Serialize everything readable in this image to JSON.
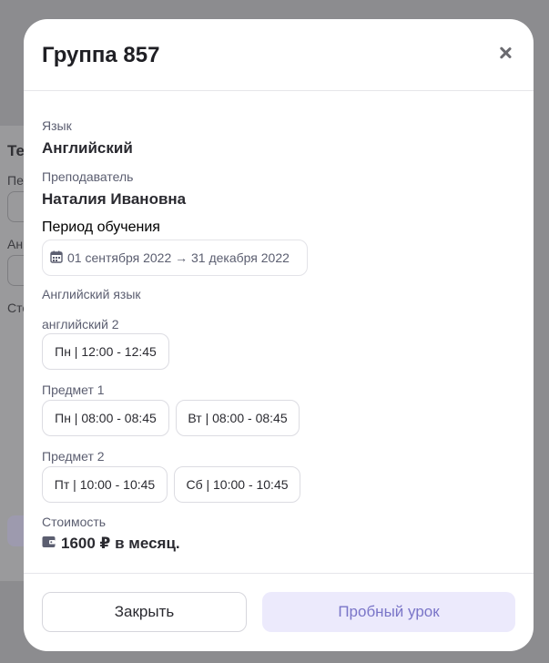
{
  "background": {
    "title_fragment": "Те",
    "label_1": "Пе",
    "label_2": "Ан",
    "label_3": "Сто"
  },
  "modal": {
    "title": "Группа 857",
    "close_icon": "close-icon",
    "language": {
      "label": "Язык",
      "value": "Английский"
    },
    "teacher": {
      "label": "Преподаватель",
      "value": "Наталия Ивановна"
    },
    "period": {
      "label": "Период обучения",
      "icon": "calendar-icon",
      "text": "01 сентября 2022 → 31 декабря 2022"
    },
    "section_title": "Английский язык",
    "subjects": [
      {
        "name": "английский 2",
        "slots": [
          "Пн | 12:00 - 12:45"
        ]
      },
      {
        "name": "Предмет 1",
        "slots": [
          "Пн | 08:00 - 08:45",
          "Вт | 08:00 - 08:45"
        ]
      },
      {
        "name": "Предмет 2",
        "slots": [
          "Пт | 10:00 - 10:45",
          "Сб | 10:00 - 10:45"
        ]
      }
    ],
    "cost": {
      "label": "Стоимость",
      "icon": "wallet-icon",
      "value": "1600 ₽ в месяц."
    },
    "footer": {
      "close_label": "Закрыть",
      "trial_label": "Пробный урок"
    }
  },
  "colors": {
    "overlay": "#8c8c8f",
    "accent_bg": "#eceafc",
    "accent_text": "#7a75c8"
  }
}
